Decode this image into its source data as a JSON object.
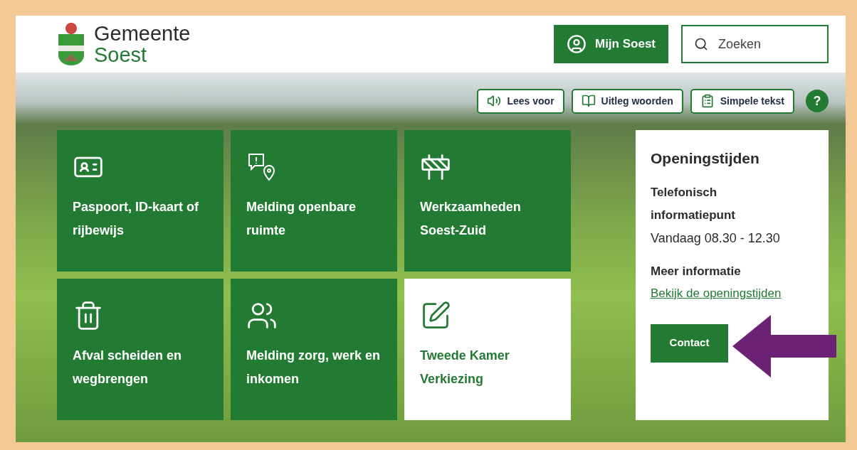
{
  "header": {
    "logo": {
      "line_1": "Gemeente",
      "line_2": "Soest"
    },
    "account_button": "Mijn Soest",
    "search": {
      "placeholder": "Zoeken"
    }
  },
  "toolbar": [
    {
      "kind": "speaker",
      "label": "Lees voor"
    },
    {
      "kind": "book",
      "label": "Uitleg woorden"
    },
    {
      "kind": "clipboard",
      "label": "Simpele tekst"
    },
    {
      "kind": "help",
      "label": "?"
    }
  ],
  "tiles": [
    {
      "kind": "id-card",
      "label": "Paspoort, ID-kaart of rijbewijs",
      "highlighted": false
    },
    {
      "kind": "report-pin",
      "label": "Melding openbare ruimte",
      "highlighted": false
    },
    {
      "kind": "roadwork",
      "label": "Werkzaamheden Soest-Zuid",
      "highlighted": false
    },
    {
      "kind": "bin-calendar",
      "label": "Afval scheiden en wegbrengen",
      "highlighted": false
    },
    {
      "kind": "people-chat",
      "label": "Melding zorg, werk en inkomen",
      "highlighted": false
    },
    {
      "kind": "ballot-pencil",
      "label": "Tweede Kamer Verkiezing",
      "highlighted": true
    }
  ],
  "opening_hours": {
    "title": "Openingstijden",
    "subtitle": "Telefonisch informatiepunt",
    "today": "Vandaag 08.30 - 12.30",
    "more_heading": "Meer informatie",
    "link": "Bekijk de openingstijden",
    "button": "Contact"
  }
}
